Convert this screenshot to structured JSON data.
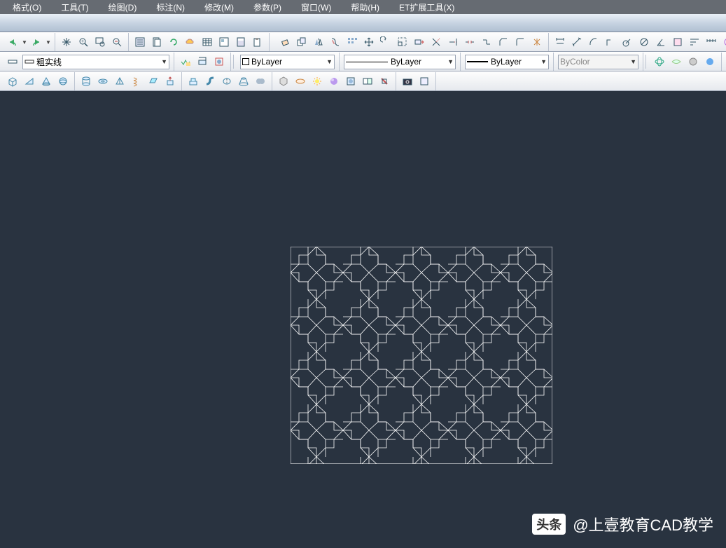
{
  "menu": {
    "items": [
      "格式(O)",
      "工具(T)",
      "绘图(D)",
      "标注(N)",
      "修改(M)",
      "参数(P)",
      "窗口(W)",
      "帮助(H)",
      "ET扩展工具(X)"
    ]
  },
  "properties": {
    "linetype_name": "粗实线",
    "layer": "ByLayer",
    "linetype": "ByLayer",
    "lineweight": "ByLayer",
    "color": "ByColor"
  },
  "watermark": {
    "badge": "头条",
    "text": "@上壹教育CAD教学"
  },
  "icons": {
    "undo": "↶",
    "redo": "↷",
    "pan": "✋",
    "zoom_window": "🔍",
    "zoom_prev": "⟲",
    "zoom_realtime": "±",
    "properties": "☰",
    "sheet": "▤",
    "refresh": "↻",
    "table": "▦"
  }
}
